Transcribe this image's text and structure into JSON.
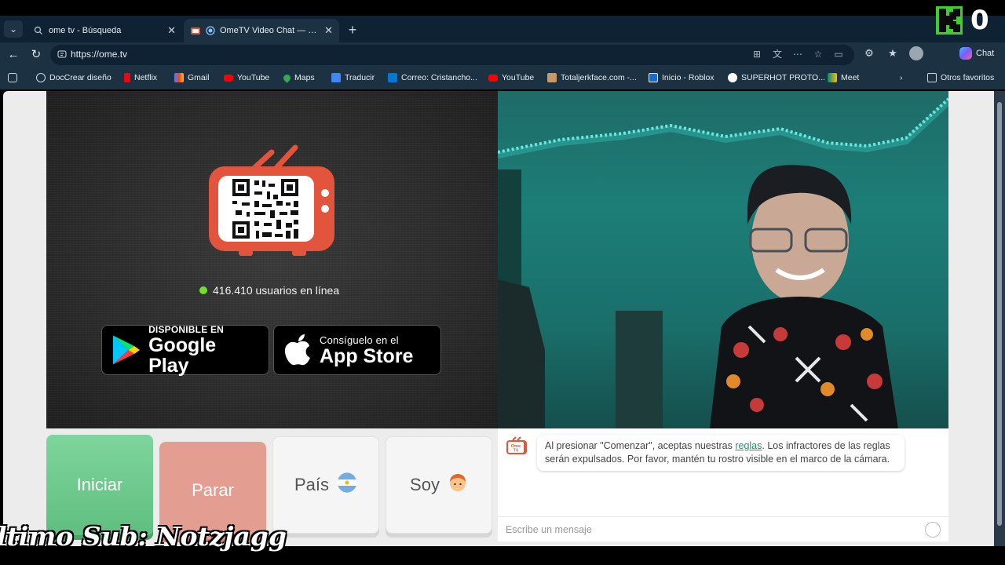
{
  "browser": {
    "tabs": [
      {
        "title": "ome tv - Búsqueda",
        "active": false
      },
      {
        "title": "OmeTV Video Chat — Omegle",
        "active": true
      }
    ],
    "new_tab_label": "+",
    "window_control": "—",
    "url": "https://ome.tv",
    "chat_label": "Chat",
    "bookmarks": [
      {
        "label": "DocCrear diseño",
        "icon": "globe-icon",
        "color": "#cfd8e0"
      },
      {
        "label": "Netflix",
        "icon": "netflix-icon",
        "color": "#e50914"
      },
      {
        "label": "Gmail",
        "icon": "gmail-icon",
        "color": "#ea4335"
      },
      {
        "label": "YouTube",
        "icon": "youtube-icon",
        "color": "#ff0000"
      },
      {
        "label": "Maps",
        "icon": "maps-icon",
        "color": "#34a853"
      },
      {
        "label": "Traducir",
        "icon": "translate-icon",
        "color": "#4285f4"
      },
      {
        "label": "Correo: Cristancho...",
        "icon": "outlook-icon",
        "color": "#0078d4"
      },
      {
        "label": "YouTube",
        "icon": "youtube-icon",
        "color": "#ff0000"
      },
      {
        "label": "Totaljerkface.com -...",
        "icon": "site-icon",
        "color": "#c49a6c"
      },
      {
        "label": "Inicio - Roblox",
        "icon": "roblox-icon",
        "color": "#e6edf2"
      },
      {
        "label": "SUPERHOT PROTO...",
        "icon": "superhot-icon",
        "color": "#ffffff"
      },
      {
        "label": "Meet",
        "icon": "meet-icon",
        "color": "#00897b"
      }
    ],
    "other_favorites": "Otros favoritos"
  },
  "ometv": {
    "online_count": "416.410 usuarios en línea",
    "google_play": {
      "small": "DISPONIBLE EN",
      "big": "Google Play"
    },
    "app_store": {
      "small": "Consíguelo en el",
      "big": "App Store"
    },
    "buttons": {
      "start": "Iniciar",
      "stop": "Parar",
      "country": "País",
      "country_flag": "🇦🇷",
      "gender": "Soy",
      "gender_emoji": "🧑"
    },
    "chat": {
      "logo_text": "Ome TV",
      "notice_before": "Al presionar \"Comenzar\", aceptas nuestras ",
      "notice_link": "reglas",
      "notice_after": ". Los infractores de las reglas serán expulsados. Por favor, mantén tu rostro visible en el marco de la cámara.",
      "input_placeholder": "Escribe un mensaje"
    },
    "colors": {
      "start": "#6fcb8e",
      "stop": "#e49e91",
      "online_dot": "#6ee02f",
      "tv_red": "#e2543b"
    }
  },
  "overlay": {
    "kick_count": "0",
    "last_sub": "ltimo Sub: Notzjagg"
  }
}
